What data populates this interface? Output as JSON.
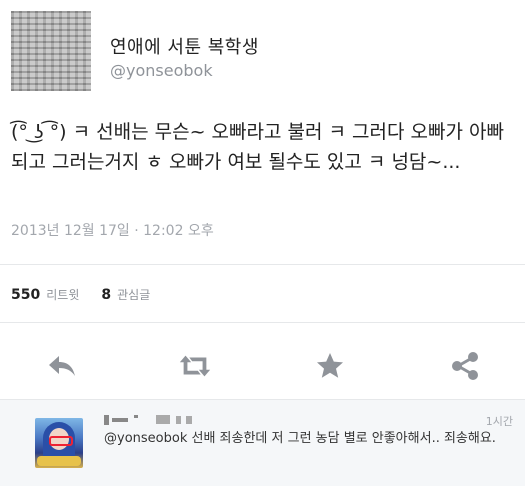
{
  "tweet": {
    "display_name": "연애에 서툰 복학생",
    "handle": "@yonseobok",
    "avatar_icon": "avatar-image",
    "text": "(͡° ͜ʖ ͡°) ㅋ 선배는 무슨~ 오빠라고 불러 ㅋ 그러다 오빠가 아빠 되고 그러는거지 ㅎ 오빠가 여보 될수도 있고 ㅋ 넝담~...",
    "timestamp": "2013년 12월 17일 · 12:02 오후"
  },
  "stats": {
    "retweets_count": "550",
    "retweets_label": "리트윗",
    "favorites_count": "8",
    "favorites_label": "관심글"
  },
  "actions": [
    {
      "name": "reply",
      "icon": "reply-icon"
    },
    {
      "name": "retweet",
      "icon": "retweet-icon"
    },
    {
      "name": "favorite",
      "icon": "star-icon"
    },
    {
      "name": "share",
      "icon": "share-icon"
    }
  ],
  "reply": {
    "time": "1시간",
    "mention": "@yonseobok",
    "text": " 선배 죄송한데 저 그런 농담 별로 안좋아해서.. 죄송해요."
  },
  "colors": {
    "icon_gray": "#8f9399",
    "secondary_text": "#8f9399",
    "reply_bg": "#f5f7f9",
    "divider": "#e6e8ea"
  }
}
